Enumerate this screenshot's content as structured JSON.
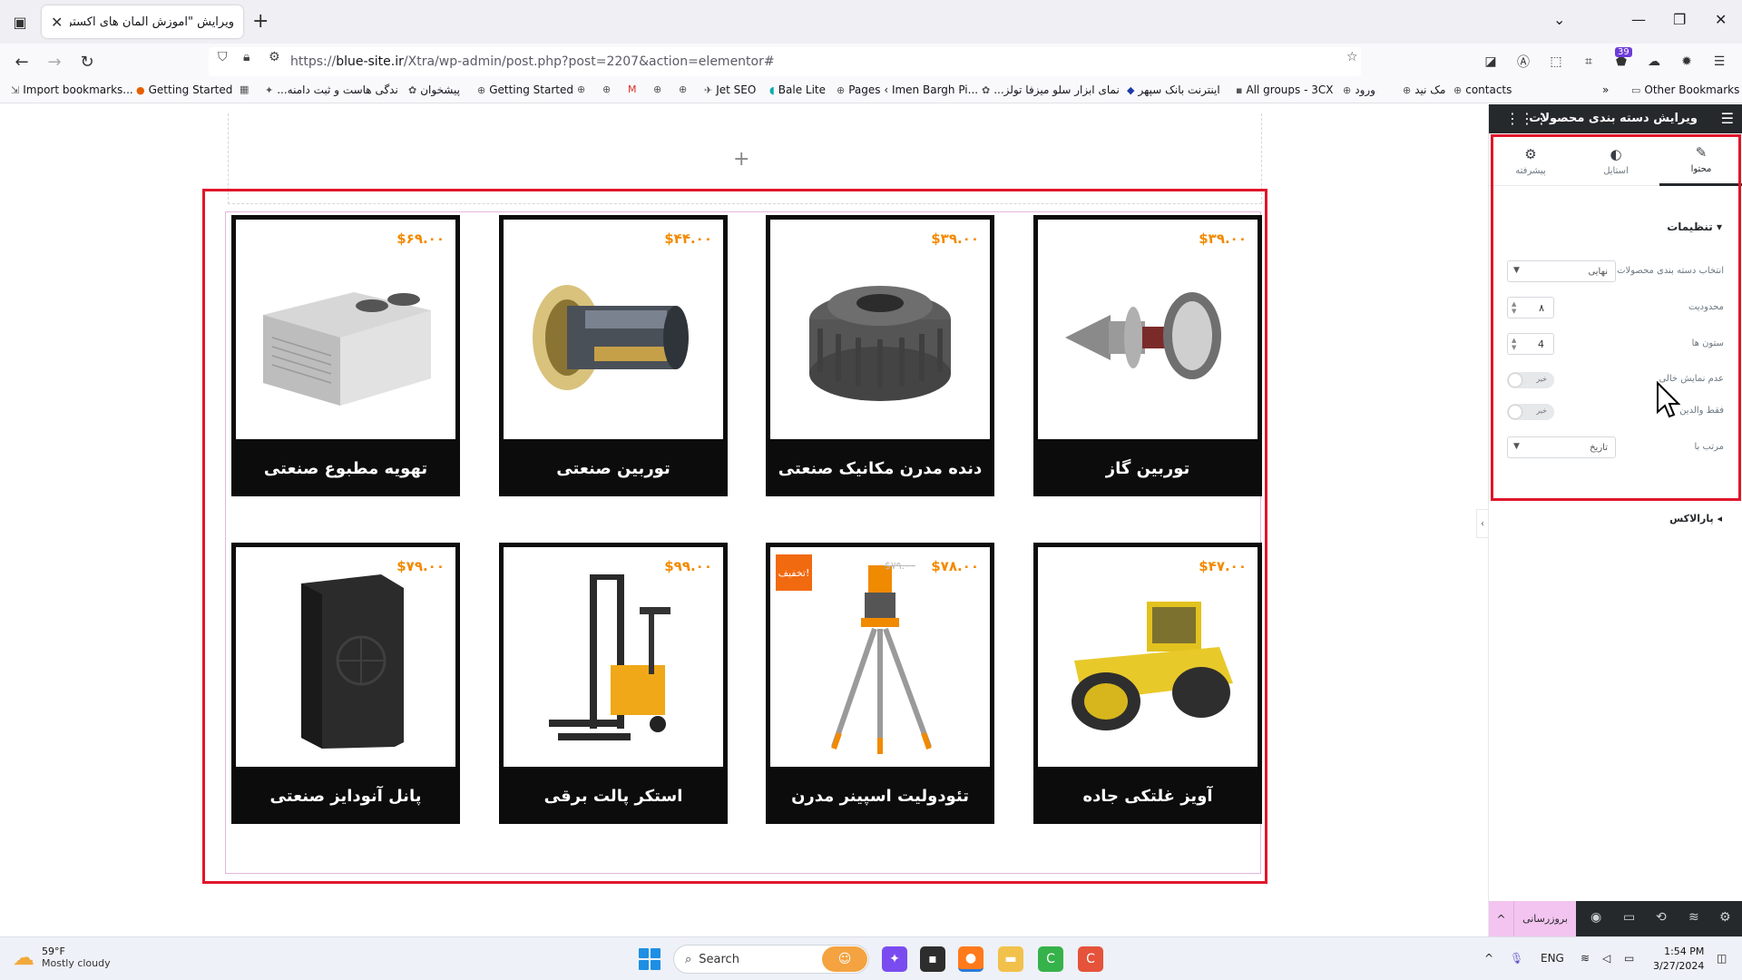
{
  "browser": {
    "tab_title": "ویرایش \"آموزش المان های اکسترا – ...",
    "url_prefix": "https://",
    "url_host": "blue-site.ir",
    "url_path": "/Xtra/wp-admin/post.php?post=2207&action=elementor#",
    "extension_badge": "39"
  },
  "bookmarks": [
    {
      "label": "Import bookmarks...",
      "icon": "import-icon"
    },
    {
      "label": "Getting Started",
      "icon": "firefox-icon"
    },
    {
      "label": "",
      "icon": "calendar-icon"
    },
    {
      "label": "...ندگی هاست و ثبت دامنه",
      "icon": "site-icon"
    },
    {
      "label": "پیشخوان",
      "icon": "site-icon"
    },
    {
      "label": "Getting Started",
      "icon": "globe-icon"
    },
    {
      "label": "",
      "icon": "globe-icon"
    },
    {
      "label": "",
      "icon": "globe-icon"
    },
    {
      "label": "",
      "icon": "gmail-icon"
    },
    {
      "label": "",
      "icon": "globe-icon"
    },
    {
      "label": "",
      "icon": "globe-icon"
    },
    {
      "label": "Jet SEO",
      "icon": "jet-icon"
    },
    {
      "label": "Bale Lite",
      "icon": "bale-icon"
    },
    {
      "label": "Pages ‹ Imen Bargh Pi...",
      "icon": "globe-icon"
    },
    {
      "label": "...نمای ابزار سلو میزفا تولز",
      "icon": "site-icon"
    },
    {
      "label": "اینترنت بانک سپهر",
      "icon": "bank-icon"
    },
    {
      "label": "All groups - 3CX",
      "icon": "3cx-icon"
    },
    {
      "label": "ورود",
      "icon": "globe-icon"
    },
    {
      "label": "مک نید",
      "icon": "globe-icon"
    },
    {
      "label": "contacts",
      "icon": "globe-icon"
    }
  ],
  "other_bookmarks": "Other Bookmarks",
  "products": [
    {
      "name": "توربین گاز",
      "price": "$۳۹.۰۰",
      "image": "turbine-icon"
    },
    {
      "name": "دنده مدرن مکانیک صنعتی",
      "price": "$۳۹.۰۰",
      "image": "gear-icon"
    },
    {
      "name": "توربین صنعتی",
      "price": "$۴۴.۰۰",
      "image": "jet-engine-icon"
    },
    {
      "name": "تهویه مطبوع صنعتی",
      "price": "$۶۹.۰۰",
      "image": "hvac-icon"
    },
    {
      "name": "آویز غلتکی جاده",
      "price": "$۴۷.۰۰",
      "image": "roller-icon"
    },
    {
      "name": "تئودولیت اسپینر مدرن",
      "price": "$۷۸.۰۰",
      "old_price": "$۷۹.۰۰",
      "badge": "تخفیف!",
      "image": "theodolite-icon"
    },
    {
      "name": "استکر پالت برقی",
      "price": "$۹۹.۰۰",
      "image": "stacker-icon"
    },
    {
      "name": "پانل آنودایز صنعتی",
      "price": "$۷۹.۰۰",
      "image": "panel-icon"
    }
  ],
  "panel": {
    "title": "ویرایش دسته بندی محصولات",
    "tabs": [
      {
        "label": "محتوا",
        "icon": "pencil-icon"
      },
      {
        "label": "استایل",
        "icon": "contrast-icon"
      },
      {
        "label": "پیشرفته",
        "icon": "gear-icon"
      }
    ],
    "section": "تنظیمات",
    "controls": {
      "category_label": "انتخاب دسته بندی محصولات",
      "category_value": "نهایی",
      "limit_label": "محدودیت",
      "limit_value": "۸",
      "columns_label": "ستون ها",
      "columns_value": "4",
      "hide_empty_label": "عدم نمایش خالی",
      "hide_empty_value": "خیر",
      "parent_only_label": "فقط والدین",
      "parent_only_value": "خیر",
      "order_by_label": "مرتب با",
      "order_by_value": "تاریخ"
    },
    "section2": "پارالاکس",
    "publish_label": "بروزرسانی"
  },
  "taskbar": {
    "temp": "59°F",
    "weather": "Mostly cloudy",
    "search": "Search",
    "lang": "ENG",
    "time": "1:54 PM",
    "date": "3/27/2024"
  }
}
